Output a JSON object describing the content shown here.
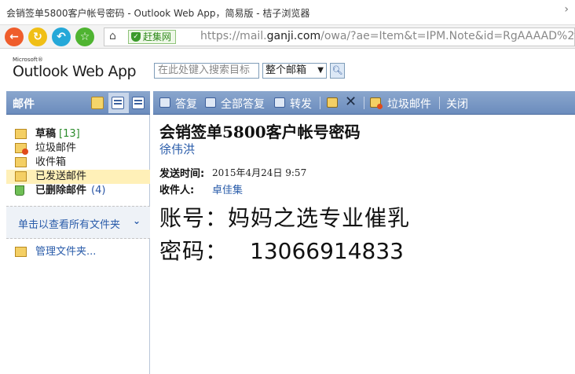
{
  "browser": {
    "window_title": "会销签单5800客户帐号密码 - Outlook Web App，简易版 - 桔子浏览器",
    "security_badge": "赶集网",
    "url_prefix": "https://mail.",
    "url_domain": "ganji.com",
    "url_rest": "/owa/?ae=Item&t=IPM.Note&id=RgAAAAD%2fru"
  },
  "owa": {
    "logo_small": "Microsoft®",
    "logo_text": "Outlook Web App",
    "search_placeholder": "在此处键入搜索目标",
    "search_scope": "整个邮箱"
  },
  "sidebar": {
    "header": "邮件",
    "folders": [
      {
        "name": "草稿",
        "count": "[13]",
        "bold": true,
        "icon": "draft-folder-icon"
      },
      {
        "name": "垃圾邮件",
        "count": "",
        "bold": false,
        "icon": "junk-folder-icon"
      },
      {
        "name": "收件箱",
        "count": "",
        "bold": false,
        "icon": "inbox-folder-icon"
      },
      {
        "name": "已发送邮件",
        "count": "",
        "bold": false,
        "icon": "sent-folder-icon",
        "selected": true
      },
      {
        "name": "已删除邮件",
        "count": "(4)",
        "bold": true,
        "icon": "trash-icon"
      }
    ],
    "all_folders_link": "单击以查看所有文件夹",
    "manage_folders": "管理文件夹..."
  },
  "toolbar": {
    "reply": "答复",
    "reply_all": "全部答复",
    "forward": "转发",
    "junk": "垃圾邮件",
    "close": "关闭"
  },
  "message": {
    "subject": "会销签单5800客户帐号密码",
    "sender": "徐伟洪",
    "sent_label": "发送时间:",
    "sent_value": "2015年4月24日  9:57",
    "to_label": "收件人:",
    "to_value": "卓佳集",
    "body_line1": "账号：妈妈之选专业催乳",
    "body_line2_label": "密码：",
    "body_line2_value": "13066914833"
  }
}
